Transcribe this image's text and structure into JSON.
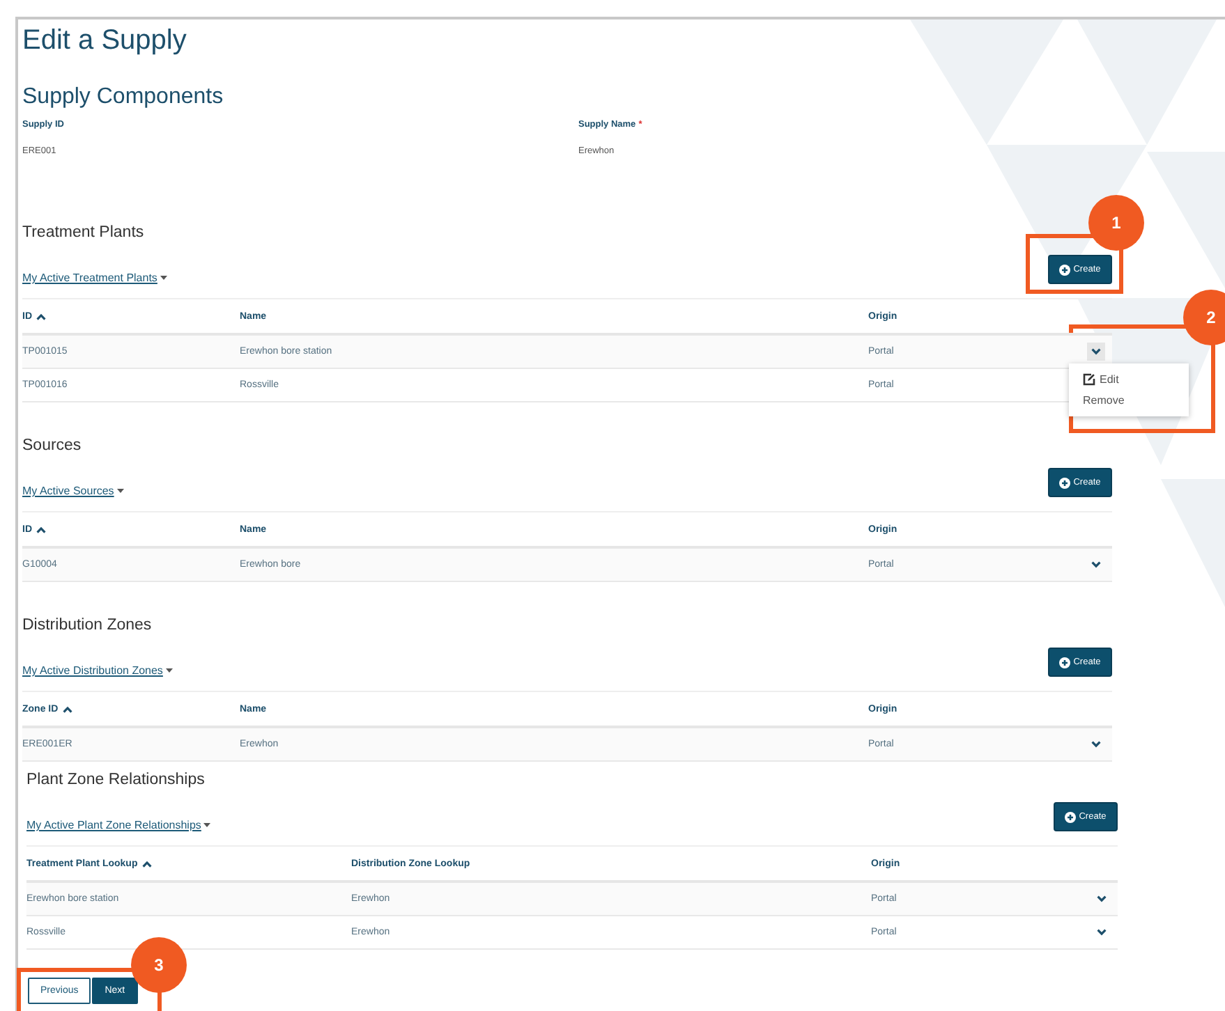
{
  "page_title": "Edit a Supply",
  "subtitle": "Supply Components",
  "fields": [
    {
      "label": "Supply ID",
      "value": "ERE001"
    },
    {
      "label": "Supply Name",
      "required_mark": "*",
      "value": "Erewhon"
    }
  ],
  "sections": [
    {
      "kind": "list",
      "heading": "Treatment Plants",
      "filter": "My Active Treatment Plants",
      "create": "Create",
      "columns": [
        {
          "label": "ID",
          "sorted": true
        },
        {
          "label": "Name",
          "sorted": false
        },
        {
          "label": "Origin",
          "sorted": false
        }
      ],
      "rows": [
        {
          "cells": [
            "TP001015",
            "Erewhon bore station",
            "Portal"
          ],
          "expanded": true,
          "menu": [
            {
              "kind": "edit",
              "label": "Edit"
            },
            {
              "kind": "remove",
              "label": "Remove"
            }
          ]
        },
        {
          "cells": [
            "TP001016",
            "Rossville",
            "Portal"
          ]
        }
      ]
    },
    {
      "kind": "list",
      "heading": "Sources",
      "filter": "My Active Sources",
      "create": "Create",
      "columns": [
        {
          "label": "ID",
          "sorted": true
        },
        {
          "label": "Name",
          "sorted": false
        },
        {
          "label": "Origin",
          "sorted": false
        }
      ],
      "rows": [
        {
          "cells": [
            "G10004",
            "Erewhon bore",
            "Portal"
          ],
          "expanded": false
        }
      ]
    },
    {
      "kind": "list",
      "heading": "Distribution Zones",
      "filter": "My Active Distribution Zones",
      "create": "Create",
      "columns": [
        {
          "label": "Zone ID",
          "sorted": true
        },
        {
          "label": "Name",
          "sorted": false
        },
        {
          "label": "Origin",
          "sorted": false
        }
      ],
      "rows": [
        {
          "cells": [
            "ERE001ER",
            "Erewhon",
            "Portal"
          ],
          "expanded": false
        }
      ]
    },
    {
      "kind": "lookup",
      "heading": "Plant Zone Relationships",
      "filter": "My Active Plant Zone Relationships",
      "create": "Create",
      "columns": [
        {
          "label": "Treatment Plant Lookup",
          "sorted": true
        },
        {
          "label": "Distribution Zone Lookup",
          "sorted": false
        },
        {
          "label": "Origin",
          "sorted": false
        }
      ],
      "rows": [
        {
          "cells": [
            "Erewhon bore station",
            "Erewhon",
            "Portal"
          ],
          "expanded": false
        },
        {
          "cells": [
            "Rossville",
            "Erewhon",
            "Portal"
          ],
          "expanded": false
        }
      ]
    }
  ],
  "pagination": [
    {
      "label": "Previous",
      "kind": "outline"
    },
    {
      "label": "Next",
      "kind": "primary"
    }
  ],
  "annotations": [
    {
      "label": "1"
    },
    {
      "label": "2"
    },
    {
      "label": "3"
    }
  ]
}
